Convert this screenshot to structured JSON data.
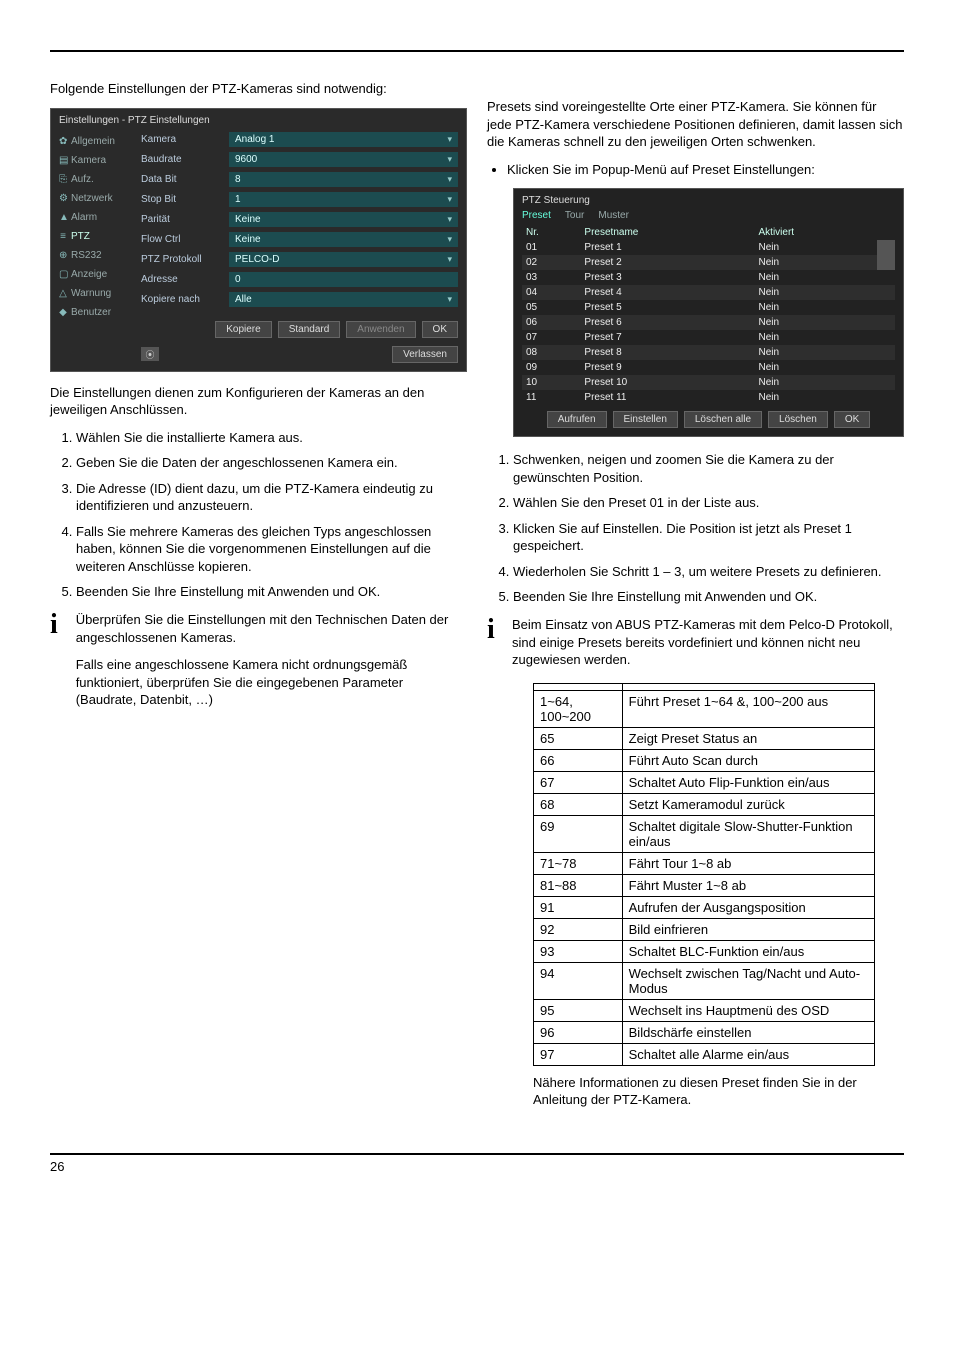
{
  "page_number": "26",
  "left": {
    "intro": "Folgende Einstellungen der PTZ-Kameras sind notwendig:",
    "dialog_title": "Einstellungen - PTZ Einstellungen",
    "sidebar": [
      {
        "label": "Allgemein",
        "icon": "✿"
      },
      {
        "label": "Kamera",
        "icon": "▤"
      },
      {
        "label": "Aufz.",
        "icon": "⎘"
      },
      {
        "label": "Netzwerk",
        "icon": "⚙"
      },
      {
        "label": "Alarm",
        "icon": "▲"
      },
      {
        "label": "PTZ",
        "icon": "≡",
        "selected": true
      },
      {
        "label": "RS232",
        "icon": "⊕"
      },
      {
        "label": "Anzeige",
        "icon": "▢"
      },
      {
        "label": "Warnung",
        "icon": "△"
      },
      {
        "label": "Benutzer",
        "icon": "◆"
      }
    ],
    "form": [
      {
        "label": "Kamera",
        "value": "Analog 1",
        "dropdown": true
      },
      {
        "label": "Baudrate",
        "value": "9600",
        "dropdown": true
      },
      {
        "label": "Data Bit",
        "value": "8",
        "dropdown": true
      },
      {
        "label": "Stop Bit",
        "value": "1",
        "dropdown": true
      },
      {
        "label": "Parität",
        "value": "Keine",
        "dropdown": true
      },
      {
        "label": "Flow Ctrl",
        "value": "Keine",
        "dropdown": true
      },
      {
        "label": "PTZ Protokoll",
        "value": "PELCO-D",
        "dropdown": true
      },
      {
        "label": "Adresse",
        "value": "0",
        "dropdown": false
      },
      {
        "label": "Kopiere nach",
        "value": "Alle",
        "dropdown": true
      }
    ],
    "buttons": {
      "kopiere": "Kopiere",
      "standard": "Standard",
      "anwenden": "Anwenden",
      "ok": "OK",
      "verlassen": "Verlassen"
    },
    "after_dialog": "Die Einstellungen dienen zum Konfigurieren der Kameras an den jeweiligen Anschlüssen.",
    "steps": [
      "Wählen Sie die installierte Kamera aus.",
      "Geben Sie die Daten der angeschlossenen Kamera ein.",
      "Die Adresse (ID) dient dazu, um die PTZ-Kamera eindeutig zu identifizieren und anzusteuern.",
      "Falls Sie mehrere Kameras des gleichen Typs angeschlossen haben, können Sie die vorgenommenen Einstellungen auf die weiteren Anschlüsse kopieren.",
      "Beenden Sie Ihre Einstellung mit Anwenden und OK."
    ],
    "info1": "Überprüfen Sie die Einstellungen mit den Technischen Daten der angeschlossenen Kameras.",
    "info2": "Falls eine angeschlossene Kamera nicht ordnungsgemäß funktioniert, überprüfen Sie die eingegebenen Parameter (Baudrate, Datenbit, …)"
  },
  "right": {
    "intro": "Presets sind voreingestellte Orte einer PTZ-Kamera. Sie können für jede PTZ-Kamera verschiedene Positionen definieren, damit lassen sich die Kameras schnell zu den jeweiligen Orten schwenken.",
    "bullet": "Klicken Sie im Popup-Menü auf Preset Einstellungen:",
    "preset_dialog": {
      "title": "PTZ Steuerung",
      "tabs": [
        "Preset",
        "Tour",
        "Muster"
      ],
      "headers": [
        "Nr.",
        "Presetname",
        "Aktiviert"
      ],
      "rows": [
        {
          "nr": "01",
          "name": "Preset 1",
          "akt": "Nein"
        },
        {
          "nr": "02",
          "name": "Preset 2",
          "akt": "Nein"
        },
        {
          "nr": "03",
          "name": "Preset 3",
          "akt": "Nein"
        },
        {
          "nr": "04",
          "name": "Preset 4",
          "akt": "Nein"
        },
        {
          "nr": "05",
          "name": "Preset 5",
          "akt": "Nein"
        },
        {
          "nr": "06",
          "name": "Preset 6",
          "akt": "Nein"
        },
        {
          "nr": "07",
          "name": "Preset 7",
          "akt": "Nein"
        },
        {
          "nr": "08",
          "name": "Preset 8",
          "akt": "Nein"
        },
        {
          "nr": "09",
          "name": "Preset 9",
          "akt": "Nein"
        },
        {
          "nr": "10",
          "name": "Preset 10",
          "akt": "Nein"
        },
        {
          "nr": "11",
          "name": "Preset 11",
          "akt": "Nein"
        }
      ],
      "buttons": [
        "Aufrufen",
        "Einstellen",
        "Löschen alle",
        "Löschen",
        "OK"
      ]
    },
    "steps": [
      "Schwenken, neigen und zoomen Sie die Kamera zu der gewünschten Position.",
      "Wählen Sie den Preset 01 in der Liste aus.",
      "Klicken Sie auf Einstellen. Die Position ist jetzt als Preset 1 gespeichert.",
      "Wiederholen Sie Schritt 1 – 3, um weitere Presets zu definieren.",
      "Beenden Sie Ihre Einstellung mit Anwenden und OK."
    ],
    "info": "Beim Einsatz von ABUS PTZ-Kameras mit dem Pelco-D Protokoll, sind einige Presets bereits vordefiniert und können nicht neu zugewiesen werden.",
    "table": [
      {
        "c1": "",
        "c2": ""
      },
      {
        "c1": "1~64, 100~200",
        "c2": "Führt Preset 1~64 &, 100~200 aus"
      },
      {
        "c1": "65",
        "c2": "Zeigt Preset Status an"
      },
      {
        "c1": "66",
        "c2": "Führt Auto Scan durch"
      },
      {
        "c1": "67",
        "c2": "Schaltet Auto Flip-Funktion ein/aus"
      },
      {
        "c1": "68",
        "c2": "Setzt Kameramodul zurück"
      },
      {
        "c1": "69",
        "c2": "Schaltet digitale Slow-Shutter-Funktion ein/aus"
      },
      {
        "c1": "71~78",
        "c2": "Fährt Tour 1~8 ab"
      },
      {
        "c1": "81~88",
        "c2": "Fährt Muster 1~8 ab"
      },
      {
        "c1": "91",
        "c2": "Aufrufen der Ausgangsposition"
      },
      {
        "c1": "92",
        "c2": "Bild einfrieren"
      },
      {
        "c1": "93",
        "c2": "Schaltet BLC-Funktion ein/aus"
      },
      {
        "c1": "94",
        "c2": "Wechselt zwischen Tag/Nacht und Auto-Modus"
      },
      {
        "c1": "95",
        "c2": "Wechselt ins Hauptmenü des OSD"
      },
      {
        "c1": "96",
        "c2": "Bildschärfe einstellen"
      },
      {
        "c1": "97",
        "c2": "Schaltet alle Alarme ein/aus"
      }
    ],
    "footnote": "Nähere Informationen zu diesen Preset finden Sie in der Anleitung der PTZ-Kamera."
  }
}
